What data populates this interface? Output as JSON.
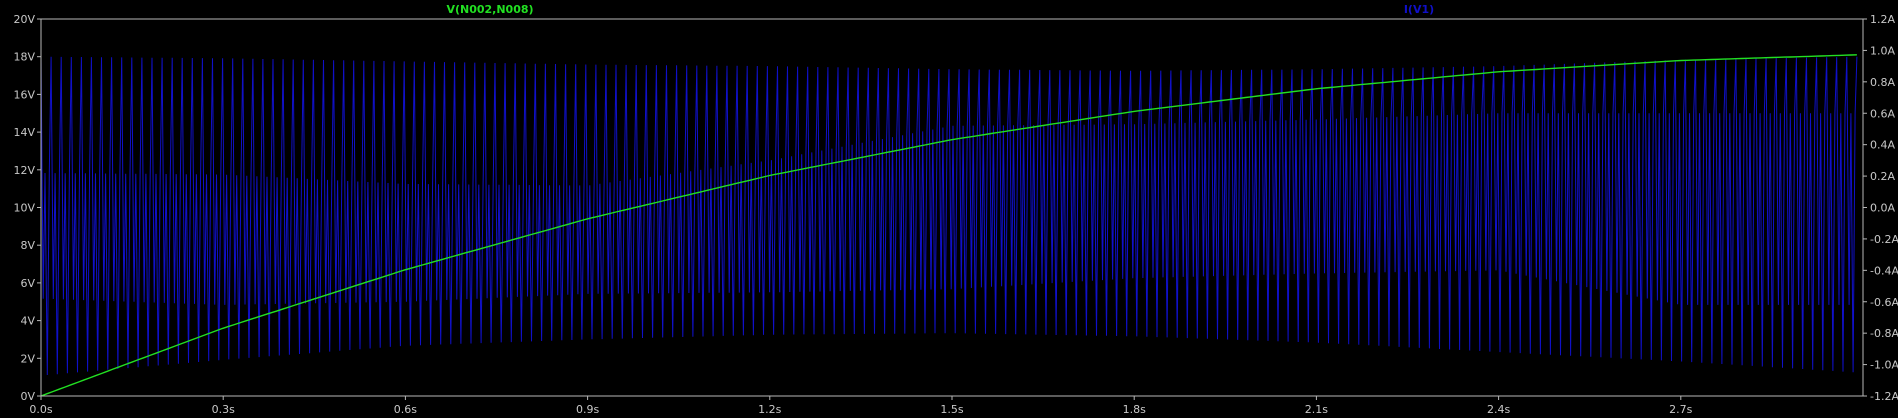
{
  "traces": {
    "voltage_label": "V(N002,N008)",
    "current_label": "I(V1)",
    "voltage_color": "#22e022",
    "current_color": "#1010c8"
  },
  "colors": {
    "background": "#000000",
    "axes": "#b8b8b8",
    "tick_text": "#c8c8c8"
  },
  "chart_data": {
    "type": "line",
    "title": "",
    "grid": false,
    "legend": "top (trace names above plot)",
    "x_axis": {
      "range": [
        0.0,
        3.0
      ],
      "ticks": [
        0.0,
        0.3,
        0.6,
        0.9,
        1.2,
        1.5,
        1.8,
        2.1,
        2.4,
        2.7
      ],
      "tick_labels": [
        "0.0s",
        "0.3s",
        "0.6s",
        "0.9s",
        "1.2s",
        "1.5s",
        "1.8s",
        "2.1s",
        "2.4s",
        "2.7s"
      ]
    },
    "y_left": {
      "range": [
        0,
        20
      ],
      "ticks": [
        0,
        2,
        4,
        6,
        8,
        10,
        12,
        14,
        16,
        18,
        20
      ],
      "tick_labels": [
        "0V",
        "2V",
        "4V",
        "6V",
        "8V",
        "10V",
        "12V",
        "14V",
        "16V",
        "18V",
        "20V"
      ]
    },
    "y_right": {
      "range": [
        -1.2,
        1.2
      ],
      "ticks": [
        -1.2,
        -1.0,
        -0.8,
        -0.6,
        -0.4,
        -0.2,
        0.0,
        0.2,
        0.4,
        0.6,
        0.8,
        1.0,
        1.2
      ],
      "tick_labels": [
        "-1.2A",
        "-1.0A",
        "-0.8A",
        "-0.6A",
        "-0.4A",
        "-0.2A",
        "0.0A",
        "0.2A",
        "0.4A",
        "0.6A",
        "0.8A",
        "1.0A",
        "1.2A"
      ]
    },
    "series": [
      {
        "name": "V(N002,N008)",
        "axis": "left",
        "kind": "rc-charging",
        "x": [
          0.0,
          0.3,
          0.6,
          0.9,
          1.2,
          1.5,
          1.8,
          2.1,
          2.4,
          2.7,
          2.99
        ],
        "y": [
          0.0,
          3.6,
          6.7,
          9.4,
          11.7,
          13.6,
          15.1,
          16.3,
          17.2,
          17.8,
          18.1
        ]
      },
      {
        "name": "I(V1)",
        "axis": "right",
        "kind": "oscillating-envelope",
        "periods": 180,
        "x": [
          0.0,
          0.3,
          0.6,
          0.9,
          1.2,
          1.5,
          1.8,
          2.1,
          2.4,
          2.7,
          2.99
        ],
        "upper": [
          0.96,
          0.95,
          0.93,
          0.91,
          0.9,
          0.88,
          0.87,
          0.88,
          0.9,
          0.94,
          0.96
        ],
        "lower": [
          -1.07,
          -0.97,
          -0.88,
          -0.84,
          -0.81,
          -0.8,
          -0.82,
          -0.86,
          -0.92,
          -0.98,
          -1.05
        ],
        "mid_upper": [
          0.22,
          0.21,
          0.15,
          0.14,
          0.3,
          0.52,
          0.53,
          0.56,
          0.6,
          0.6,
          0.6
        ],
        "mid_lower": [
          -0.58,
          -0.62,
          -0.6,
          -0.55,
          -0.54,
          -0.52,
          -0.45,
          -0.42,
          -0.4,
          -0.62,
          -0.62
        ]
      }
    ]
  }
}
